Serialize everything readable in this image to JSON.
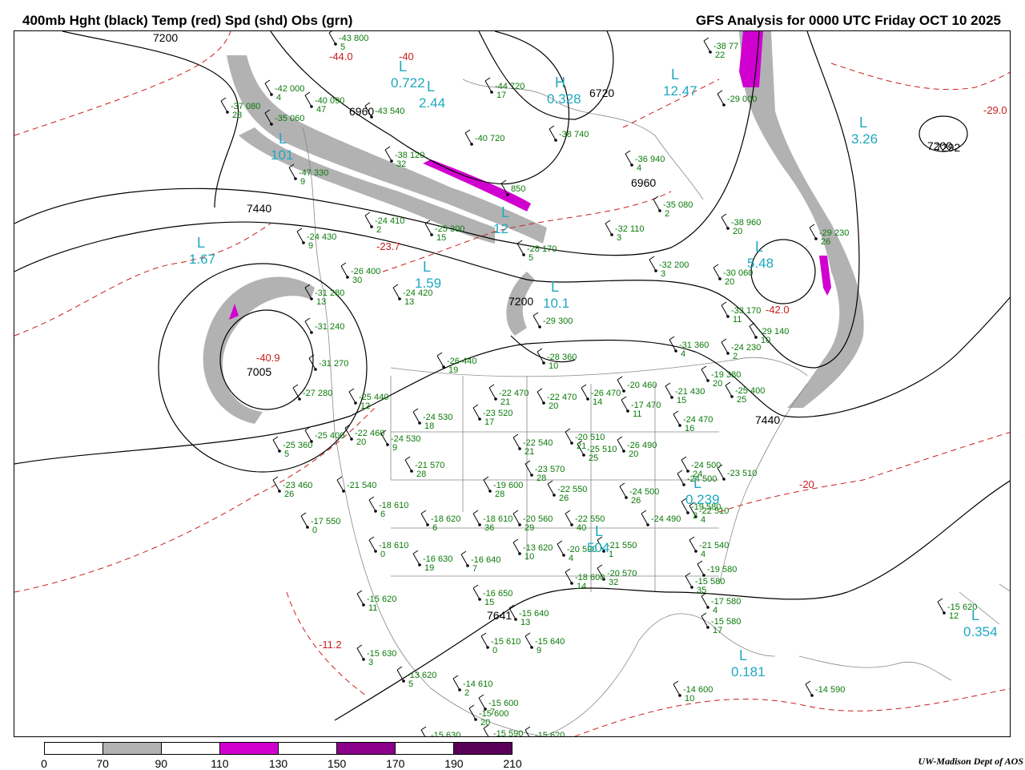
{
  "header": {
    "title_left": "400mb Hght (black) Temp (red) Spd (shd) Obs (grn)",
    "title_right": "GFS Analysis for 0000 UTC Friday  OCT 10 2025"
  },
  "legend": {
    "ticks": [
      "0",
      "70",
      "90",
      "110",
      "130",
      "150",
      "170",
      "190",
      "210"
    ],
    "colors": [
      "#ffffff",
      "#b2b2b2",
      "#ffffff",
      "#d000d0",
      "#ffffff",
      "#8a008a",
      "#ffffff",
      "#5a005a"
    ]
  },
  "credit": "UW-Madison   Dept of AOS",
  "colors": {
    "height": "#000000",
    "temperature": "#c81e1e",
    "obs": "#0a7a0a",
    "pressure_centers": "#1fa8c0",
    "map_lines": "#888888",
    "speed_70": "#b2b2b2",
    "speed_110": "#d000d0"
  },
  "height_labels": [
    "7200",
    "6960",
    "6720",
    "6960",
    "7440",
    "7200",
    "7005",
    "7440",
    "7292",
    "7641",
    "7200"
  ],
  "temp_labels": [
    "-44.0",
    "-40",
    "-23.7",
    "-40.9",
    "-42.0",
    "-11.2",
    "-20",
    "-29.0"
  ],
  "centers": [
    {
      "type": "L",
      "value": "0.722"
    },
    {
      "type": "L",
      "value": "2.44"
    },
    {
      "type": "H",
      "value": "0.328"
    },
    {
      "type": "L",
      "value": "12.47"
    },
    {
      "type": "L",
      "value": "3.26"
    },
    {
      "type": "L",
      "value": "101"
    },
    {
      "type": "L",
      "value": "1.67"
    },
    {
      "type": "L",
      "value": "1.59"
    },
    {
      "type": "L",
      "value": "10.1"
    },
    {
      "type": "L",
      "value": "5.48"
    },
    {
      "type": "L",
      "value": "0.239"
    },
    {
      "type": "L",
      "value": "0.354"
    },
    {
      "type": "L",
      "value": "0.181"
    },
    {
      "type": "L",
      "value": "504"
    },
    {
      "type": "L",
      "value": "12"
    }
  ],
  "observations": [
    {
      "line1": "-43 800",
      "line2": "5"
    },
    {
      "line1": "-42 000",
      "line2": "4"
    },
    {
      "line1": "-37 080",
      "line2": "23"
    },
    {
      "line1": "-40 090",
      "line2": "47"
    },
    {
      "line1": "-35 060",
      "line2": ""
    },
    {
      "line1": "-43 540",
      "line2": ""
    },
    {
      "line1": "-44 720",
      "line2": "17"
    },
    {
      "line1": "-40 720",
      "line2": ""
    },
    {
      "line1": "-38 740",
      "line2": ""
    },
    {
      "line1": "-38 77",
      "line2": "22"
    },
    {
      "line1": "-29 000",
      "line2": ""
    },
    {
      "line1": "-47 330",
      "line2": "9"
    },
    {
      "line1": "-38 120",
      "line2": "32"
    },
    {
      "line1": "-36 940",
      "line2": "4"
    },
    {
      "line1": "850",
      "line2": ""
    },
    {
      "line1": "-35 080",
      "line2": "2"
    },
    {
      "line1": "-24 410",
      "line2": "2"
    },
    {
      "line1": "-24 430",
      "line2": "9"
    },
    {
      "line1": "-25 300",
      "line2": "15"
    },
    {
      "line1": "-32 110",
      "line2": "3"
    },
    {
      "line1": "-28 170",
      "line2": "5"
    },
    {
      "line1": "-38 960",
      "line2": "20"
    },
    {
      "line1": "-29 230",
      "line2": "26"
    },
    {
      "line1": "-26 400",
      "line2": "30"
    },
    {
      "line1": "-24 420",
      "line2": "13"
    },
    {
      "line1": "-32 200",
      "line2": "3"
    },
    {
      "line1": "-30 060",
      "line2": "20"
    },
    {
      "line1": "-31 280",
      "line2": "13"
    },
    {
      "line1": "-31 240",
      "line2": ""
    },
    {
      "line1": "-29 300",
      "line2": ""
    },
    {
      "line1": "-33 170",
      "line2": "11"
    },
    {
      "line1": "-29 140",
      "line2": "10"
    },
    {
      "line1": "-31 360",
      "line2": "4"
    },
    {
      "line1": "-24 230",
      "line2": "2"
    },
    {
      "line1": "-26 440",
      "line2": "19"
    },
    {
      "line1": "-28 360",
      "line2": "10"
    },
    {
      "line1": "-31 270",
      "line2": ""
    },
    {
      "line1": "-19 380",
      "line2": "20"
    },
    {
      "line1": "-27 280",
      "line2": ""
    },
    {
      "line1": "-25 440",
      "line2": "12"
    },
    {
      "line1": "-22 470",
      "line2": "21"
    },
    {
      "line1": "-22 470",
      "line2": "20"
    },
    {
      "line1": "-26 470",
      "line2": "14"
    },
    {
      "line1": "-17 470",
      "line2": "11"
    },
    {
      "line1": "-20 460",
      "line2": ""
    },
    {
      "line1": "-21 430",
      "line2": "15"
    },
    {
      "line1": "-25 400",
      "line2": "25"
    },
    {
      "line1": "-24 530",
      "line2": "18"
    },
    {
      "line1": "-23 520",
      "line2": "17"
    },
    {
      "line1": "-24 470",
      "line2": "16"
    },
    {
      "line1": "-25 400",
      "line2": ""
    },
    {
      "line1": "-22 460",
      "line2": "20"
    },
    {
      "line1": "-24 530",
      "line2": "9"
    },
    {
      "line1": "-22 540",
      "line2": "21"
    },
    {
      "line1": "-20 510",
      "line2": "21"
    },
    {
      "line1": "-25 510",
      "line2": "25"
    },
    {
      "line1": "-26 490",
      "line2": "20"
    },
    {
      "line1": "-25 360",
      "line2": "5"
    },
    {
      "line1": "-21 570",
      "line2": "28"
    },
    {
      "line1": "-23 570",
      "line2": "28"
    },
    {
      "line1": "-23 460",
      "line2": "26"
    },
    {
      "line1": "-21 540",
      "line2": ""
    },
    {
      "line1": "-19 600",
      "line2": "28"
    },
    {
      "line1": "-22 550",
      "line2": "26"
    },
    {
      "line1": "-24 500",
      "line2": "26"
    },
    {
      "line1": "-24 500",
      "line2": "24"
    },
    {
      "line1": "-24 500",
      "line2": ""
    },
    {
      "line1": "-23 510",
      "line2": ""
    },
    {
      "line1": "-19 580",
      "line2": "3"
    },
    {
      "line1": "-18 610",
      "line2": "6"
    },
    {
      "line1": "-18 620",
      "line2": "6"
    },
    {
      "line1": "-18 610",
      "line2": "36"
    },
    {
      "line1": "-20 560",
      "line2": "29"
    },
    {
      "line1": "-22 550",
      "line2": "40"
    },
    {
      "line1": "-24 490",
      "line2": ""
    },
    {
      "line1": "-22 510",
      "line2": "4"
    },
    {
      "line1": "-17 550",
      "line2": "0"
    },
    {
      "line1": "-18 610",
      "line2": "0"
    },
    {
      "line1": "-16 630",
      "line2": "19"
    },
    {
      "line1": "-16 640",
      "line2": "7"
    },
    {
      "line1": "-13 620",
      "line2": "10"
    },
    {
      "line1": "-20 590",
      "line2": "4"
    },
    {
      "line1": "-21 550",
      "line2": "1"
    },
    {
      "line1": "-21 540",
      "line2": "4"
    },
    {
      "line1": "-19 580",
      "line2": ""
    },
    {
      "line1": "-18 600",
      "line2": "14"
    },
    {
      "line1": "-20 570",
      "line2": "32"
    },
    {
      "line1": "-15 580",
      "line2": "35"
    },
    {
      "line1": "-17 580",
      "line2": "4"
    },
    {
      "line1": "-15 620",
      "line2": "11"
    },
    {
      "line1": "-16 650",
      "line2": "15"
    },
    {
      "line1": "-15 640",
      "line2": "13"
    },
    {
      "line1": "-15 580",
      "line2": "17"
    },
    {
      "line1": "-15 620",
      "line2": "12"
    },
    {
      "line1": "-15 610",
      "line2": "0"
    },
    {
      "line1": "-15 640",
      "line2": "9"
    },
    {
      "line1": "-15 630",
      "line2": "3"
    },
    {
      "line1": "-13 620",
      "line2": "5"
    },
    {
      "line1": "-14 610",
      "line2": "2"
    },
    {
      "line1": "-15 600",
      "line2": "7"
    },
    {
      "line1": "-15 600",
      "line2": "20"
    },
    {
      "line1": "-14 600",
      "line2": "10"
    },
    {
      "line1": "-14 590",
      "line2": ""
    },
    {
      "line1": "-15 630",
      "line2": ""
    },
    {
      "line1": "-15 590",
      "line2": ""
    },
    {
      "line1": "-15 620",
      "line2": "12"
    }
  ]
}
